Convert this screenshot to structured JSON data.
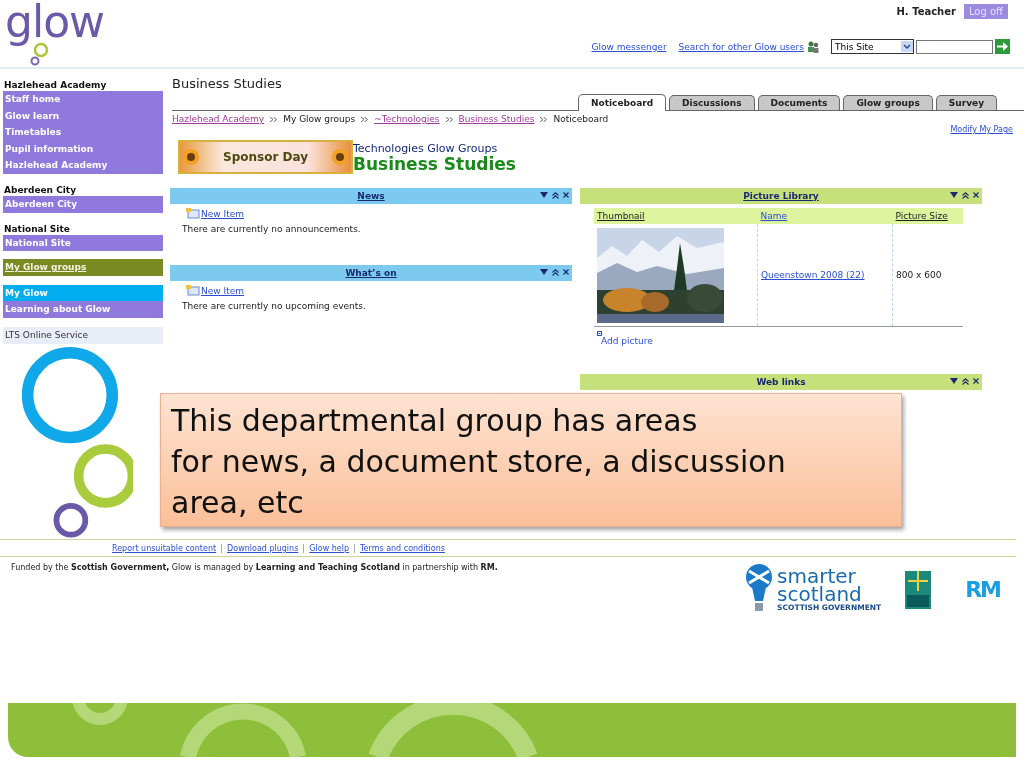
{
  "header": {
    "logo": "glow",
    "user": "H. Teacher",
    "logoff": "Log off",
    "links": [
      "Glow messenger",
      "Search for other Glow users"
    ],
    "scope": "This Site"
  },
  "sidebar": [
    {
      "heading": "Hazlehead Academy",
      "items": [
        {
          "label": "Staff home",
          "kind": "menu",
          "color": "#8f79dc"
        },
        {
          "label": "Glow learn",
          "kind": "menu",
          "color": "#8f79dc"
        },
        {
          "label": "Timetables",
          "kind": "menu",
          "color": "#8f79dc"
        },
        {
          "label": "Pupil information",
          "kind": "menu",
          "color": "#8f79dc"
        },
        {
          "label": "Hazlehead Academy",
          "kind": "menu",
          "color": "#8f79dc"
        }
      ]
    },
    {
      "heading": "Aberdeen City",
      "items": [
        {
          "label": "Aberdeen City",
          "kind": "menu",
          "color": "#8f79dc"
        }
      ]
    },
    {
      "heading": "National Site",
      "items": [
        {
          "label": "National Site",
          "kind": "menu",
          "color": "#8f79dc"
        }
      ]
    },
    {
      "items": [
        {
          "label": "My Glow groups",
          "kind": "link",
          "color": "#7a8a22"
        }
      ]
    },
    {
      "items": [
        {
          "label": "My Glow",
          "kind": "menu",
          "color": "#00aeef"
        },
        {
          "label": "Learning about Glow",
          "kind": "menu",
          "color": "#8f79dc"
        }
      ]
    },
    {
      "items": [
        {
          "label": "LTS Online Service",
          "kind": "service",
          "color": "#e8edf7"
        }
      ]
    }
  ],
  "page_title": "Business Studies",
  "tabs": [
    {
      "label": "Noticeboard",
      "selected": true
    },
    {
      "label": "Discussions",
      "selected": false
    },
    {
      "label": "Documents",
      "selected": false
    },
    {
      "label": "Glow groups",
      "selected": false
    },
    {
      "label": "Survey",
      "selected": false
    }
  ],
  "breadcrumb": [
    {
      "label": "Hazlehead Academy",
      "link": true
    },
    {
      "label": "My Glow groups",
      "link": false
    },
    {
      "label": "~Technologies",
      "link": true
    },
    {
      "label": "Business Studies",
      "link": true
    },
    {
      "label": "Noticeboard",
      "link": false
    }
  ],
  "modify_link": "Modify My Page",
  "sponsor_banner": "Sponsor Day",
  "group_label": "Technologies Glow Groups",
  "group_title": "Business Studies",
  "zones": [
    {
      "webparts": [
        {
          "kind": "announcements",
          "title": "News",
          "new_item": "New Item",
          "message": "There are currently no announcements."
        },
        {
          "kind": "announcements",
          "title": "What’s on",
          "new_item": "New Item",
          "message": "There are currently no upcoming events."
        }
      ]
    },
    {
      "webparts": [
        {
          "kind": "pictures",
          "title": "Picture Library",
          "columns": [
            "Thumbnail",
            "Name",
            "Picture Size"
          ],
          "rows": [
            {
              "name": "Queenstown 2008 (22)",
              "size": "800 x 600"
            }
          ],
          "add": "Add picture"
        },
        {
          "kind": "links",
          "title": "Web links"
        }
      ]
    }
  ],
  "callout": "This departmental group has areas\nfor news, a document store, a discussion\narea, etc",
  "footer": {
    "links": [
      "Report unsuitable content",
      "Download plugins",
      "Glow help",
      "Terms and conditions"
    ],
    "credit": "Funded by the **Scottish Government,** Glow is managed by **Learning and Teaching Scotland** in partnership with **RM.**",
    "partner_logo": {
      "line1": "smarter",
      "line2": "scotland",
      "line3": "SCOTTISH GOVERNMENT"
    },
    "rm_logo": "RM"
  }
}
